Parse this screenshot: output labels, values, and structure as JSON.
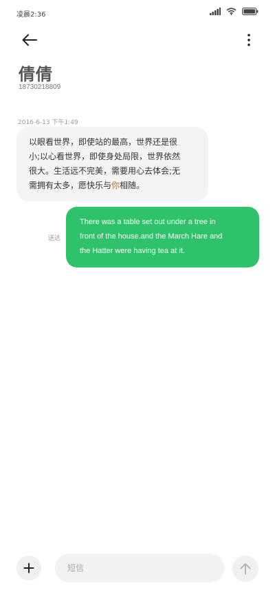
{
  "status_bar": {
    "time": "凌晨2:36",
    "icons": [
      "signal-icon",
      "wifi-icon",
      "battery-icon"
    ]
  },
  "header": {
    "back_icon": "arrow-left-icon",
    "more_icon": "more-vertical-icon"
  },
  "contact": {
    "name": "倩倩",
    "phone": "18730218809"
  },
  "conversation": {
    "timestamp": "2016-6-13 下午1:49",
    "incoming": {
      "lines": [
        "以眼看世界，即使站的最高，世界还是很",
        "小;以心看世界，即使身处局限，世界依然",
        "很大。生活远不完美，需要用心去体会;无"
      ],
      "last_line_start": "需拥有太多，愿快乐与",
      "last_line_highlight": "你",
      "last_line_end": "相随。"
    },
    "outgoing": {
      "status": "送达",
      "lines": [
        "There was a table set out under a tree in",
        "front of the house.and the March Hare and",
        "the Hatter were having tea at it."
      ]
    }
  },
  "composer": {
    "add_icon": "plus-icon",
    "input_placeholder": "短信",
    "send_icon": "arrow-up-icon"
  },
  "colors": {
    "outgoing_bubble": "#2ec26b",
    "incoming_bubble": "#f4f4f4",
    "highlight_text": "#b07a3a"
  }
}
